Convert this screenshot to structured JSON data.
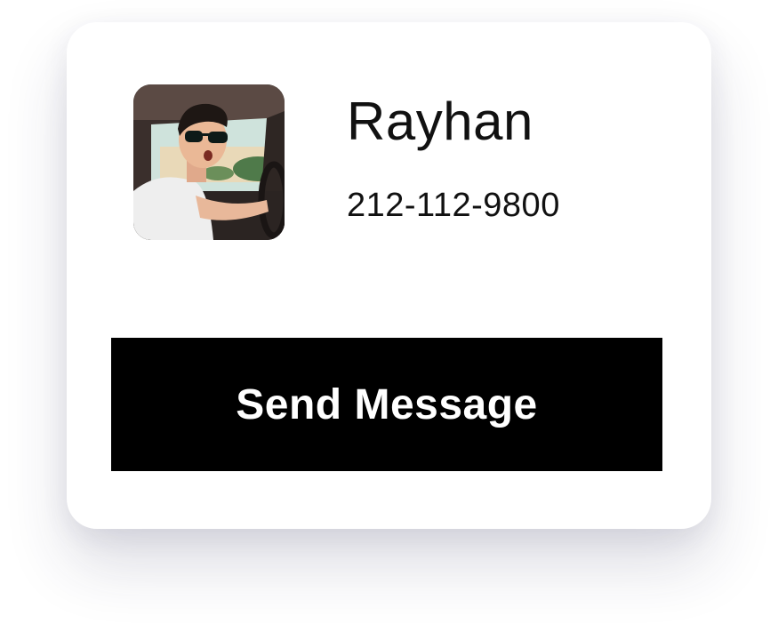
{
  "contact": {
    "name": "Rayhan",
    "phone": "212-112-9800"
  },
  "actions": {
    "send_label": "Send Message"
  },
  "colors": {
    "button_background": "#000000",
    "button_text": "#ffffff",
    "card_background": "#ffffff",
    "text": "#111111"
  }
}
